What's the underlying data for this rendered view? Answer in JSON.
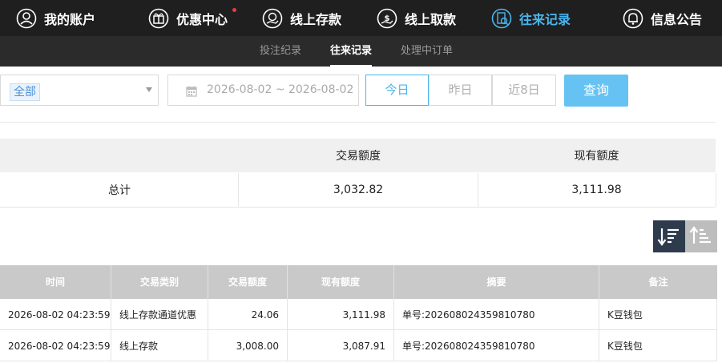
{
  "nav": {
    "items": [
      {
        "label": "我的账户",
        "icon": "user-icon",
        "active": false
      },
      {
        "label": "优惠中心",
        "icon": "gift-icon",
        "active": false,
        "badge": true
      },
      {
        "label": "线上存款",
        "icon": "deposit-icon",
        "active": false
      },
      {
        "label": "线上取款",
        "icon": "withdraw-icon",
        "active": false
      },
      {
        "label": "往来记录",
        "icon": "record-icon",
        "active": true
      },
      {
        "label": "信息公告",
        "icon": "bell-icon",
        "active": false
      }
    ],
    "active_color": "#4ab6ee",
    "badge_color": "#e8394a"
  },
  "subnav": {
    "items": [
      {
        "label": "投注纪录",
        "active": false
      },
      {
        "label": "往来记录",
        "active": true
      },
      {
        "label": "处理中订单",
        "active": false
      }
    ]
  },
  "filter": {
    "category_selected": "全部",
    "date_range": "2026-08-02 ~ 2026-08-02",
    "ranges": [
      {
        "label": "今日",
        "active": true
      },
      {
        "label": "昨日",
        "active": false
      },
      {
        "label": "近8日",
        "active": false
      }
    ],
    "query_label": "查询",
    "query_color": "#66c2f2"
  },
  "summary": {
    "headers": [
      "",
      "交易额度",
      "现有额度"
    ],
    "row_label": "总计",
    "transaction_total": "3,032.82",
    "current_balance": "3,111.98"
  },
  "sort": {
    "desc_icon": "sort-desc-icon",
    "asc_icon": "sort-asc-icon"
  },
  "records": {
    "headers": [
      "时间",
      "交易类别",
      "交易额度",
      "现有额度",
      "摘要",
      "备注"
    ],
    "rows": [
      [
        "2026-08-02 04:23:59",
        "线上存款通道优惠",
        "24.06",
        "3,111.98",
        "单号:202608024359810780",
        "K豆钱包"
      ],
      [
        "2026-08-02 04:23:59",
        "线上存款",
        "3,008.00",
        "3,087.91",
        "单号:202608024359810780",
        "K豆钱包"
      ]
    ]
  }
}
